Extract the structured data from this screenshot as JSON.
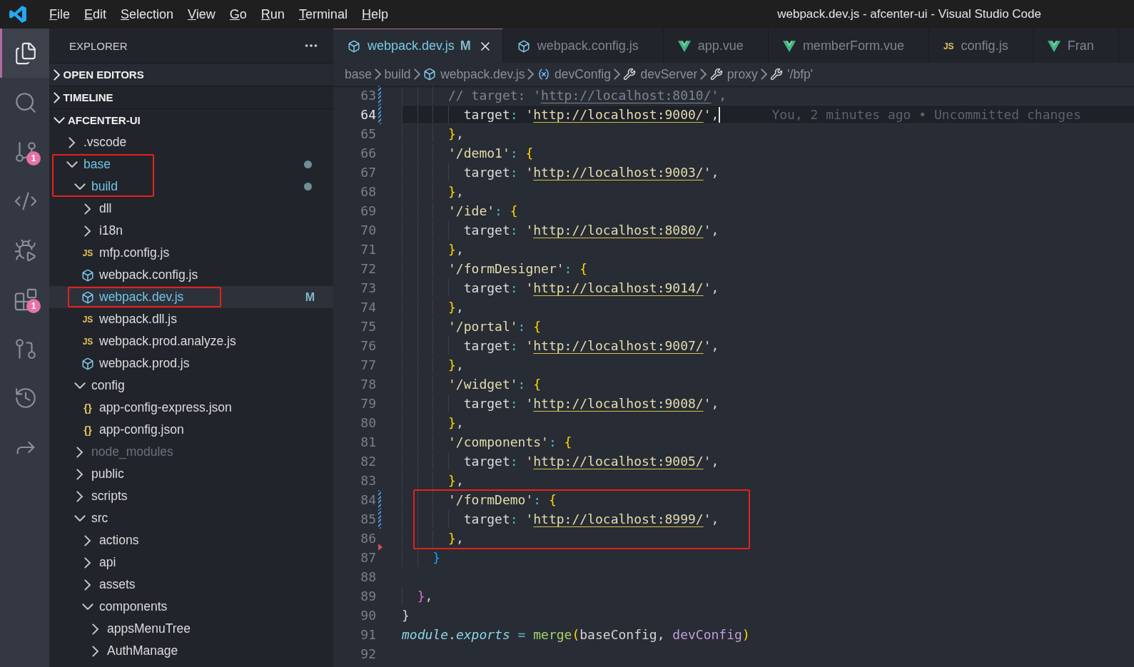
{
  "title_bar": {
    "menu": [
      "File",
      "Edit",
      "Selection",
      "View",
      "Go",
      "Run",
      "Terminal",
      "Help"
    ],
    "title": "webpack.dev.js - afcenter-ui - Visual Studio Code"
  },
  "activity_bar": [
    {
      "kind": "explorer",
      "selected": true
    },
    {
      "kind": "search",
      "selected": false
    },
    {
      "kind": "source-control",
      "selected": false,
      "badge": "1"
    },
    {
      "kind": "remote",
      "selected": false
    },
    {
      "kind": "debug",
      "selected": false
    },
    {
      "kind": "extensions",
      "selected": false,
      "badge": "1"
    },
    {
      "kind": "git-graph",
      "selected": false
    },
    {
      "kind": "git-history",
      "selected": false
    },
    {
      "kind": "share",
      "selected": false
    }
  ],
  "explorer": {
    "title": "EXPLORER",
    "sections": [
      {
        "title": "OPEN EDITORS",
        "expanded": false
      },
      {
        "title": "TIMELINE",
        "expanded": false
      },
      {
        "title": "AFCENTER-UI",
        "expanded": true,
        "tree": [
          {
            "label": ".vscode",
            "kind": "folder",
            "expanded": false,
            "selected": false,
            "modified": false,
            "ignored": false,
            "marked": false
          },
          {
            "label": "base",
            "kind": "folder",
            "expanded": true,
            "selected": false,
            "modified": true,
            "ignored": false,
            "marked": true,
            "children": [
              {
                "label": "build",
                "kind": "folder",
                "expanded": true,
                "selected": false,
                "modified": true,
                "ignored": false,
                "marked": true,
                "children": [
                  {
                    "label": "dll",
                    "kind": "folder",
                    "expanded": false,
                    "selected": false,
                    "modified": false,
                    "ignored": false,
                    "marked": false
                  },
                  {
                    "label": "i18n",
                    "kind": "folder",
                    "expanded": false,
                    "selected": false,
                    "modified": false,
                    "ignored": false,
                    "marked": false
                  },
                  {
                    "label": "mfp.config.js",
                    "kind": "file-js",
                    "icon_label": "JS",
                    "selected": false,
                    "modified": false,
                    "ignored": false,
                    "marked": false
                  },
                  {
                    "label": "webpack.config.js",
                    "kind": "file-webpack",
                    "selected": false,
                    "modified": false,
                    "ignored": false,
                    "marked": false
                  },
                  {
                    "label": "webpack.dev.js",
                    "kind": "file-webpack",
                    "selected": true,
                    "modified": true,
                    "status": "M",
                    "ignored": false,
                    "marked": true
                  },
                  {
                    "label": "webpack.dll.js",
                    "kind": "file-js",
                    "icon_label": "JS",
                    "selected": false,
                    "modified": false,
                    "ignored": false,
                    "marked": false
                  },
                  {
                    "label": "webpack.prod.analyze.js",
                    "kind": "file-js",
                    "icon_label": "JS",
                    "selected": false,
                    "modified": false,
                    "ignored": false,
                    "marked": false
                  },
                  {
                    "label": "webpack.prod.js",
                    "kind": "file-webpack",
                    "selected": false,
                    "modified": false,
                    "ignored": false,
                    "marked": false
                  }
                ]
              },
              {
                "label": "config",
                "kind": "folder",
                "expanded": true,
                "selected": false,
                "modified": false,
                "ignored": false,
                "marked": false,
                "children": [
                  {
                    "label": "app-config-express.json",
                    "kind": "file-json",
                    "icon_label": "{}",
                    "selected": false,
                    "modified": false,
                    "ignored": false,
                    "marked": false
                  },
                  {
                    "label": "app-config.json",
                    "kind": "file-json",
                    "icon_label": "{}",
                    "selected": false,
                    "modified": false,
                    "ignored": false,
                    "marked": false
                  }
                ]
              },
              {
                "label": "node_modules",
                "kind": "folder",
                "expanded": false,
                "selected": false,
                "modified": false,
                "ignored": true,
                "marked": false
              },
              {
                "label": "public",
                "kind": "folder",
                "expanded": false,
                "selected": false,
                "modified": false,
                "ignored": false,
                "marked": false
              },
              {
                "label": "scripts",
                "kind": "folder",
                "expanded": false,
                "selected": false,
                "modified": false,
                "ignored": false,
                "marked": false
              },
              {
                "label": "src",
                "kind": "folder",
                "expanded": true,
                "selected": false,
                "modified": false,
                "ignored": false,
                "marked": false,
                "children": [
                  {
                    "label": "actions",
                    "kind": "folder",
                    "expanded": false,
                    "selected": false,
                    "modified": false,
                    "ignored": false,
                    "marked": false
                  },
                  {
                    "label": "api",
                    "kind": "folder",
                    "expanded": false,
                    "selected": false,
                    "modified": false,
                    "ignored": false,
                    "marked": false
                  },
                  {
                    "label": "assets",
                    "kind": "folder",
                    "expanded": false,
                    "selected": false,
                    "modified": false,
                    "ignored": false,
                    "marked": false
                  },
                  {
                    "label": "components",
                    "kind": "folder",
                    "expanded": true,
                    "selected": false,
                    "modified": false,
                    "ignored": false,
                    "marked": false,
                    "children": [
                      {
                        "label": "appsMenuTree",
                        "kind": "folder",
                        "expanded": false,
                        "selected": false,
                        "modified": false,
                        "ignored": false,
                        "marked": false
                      },
                      {
                        "label": "AuthManage",
                        "kind": "folder",
                        "expanded": false,
                        "selected": false,
                        "modified": false,
                        "ignored": false,
                        "marked": false
                      }
                    ]
                  }
                ]
              }
            ]
          }
        ]
      }
    ]
  },
  "editor": {
    "tabs": [
      {
        "label": "webpack.dev.js",
        "kind": "webpack",
        "status": "M",
        "selected": true
      },
      {
        "label": "webpack.config.js",
        "kind": "webpack",
        "selected": false
      },
      {
        "label": "app.vue",
        "kind": "vue",
        "selected": false
      },
      {
        "label": "memberForm.vue",
        "kind": "vue",
        "selected": false
      },
      {
        "label": "config.js",
        "kind": "js",
        "icon_label": "JS",
        "selected": false
      },
      {
        "label": "Fran",
        "kind": "vue",
        "selected": false
      }
    ],
    "breadcrumb": [
      {
        "label": "base",
        "kind": "folder"
      },
      {
        "label": "build",
        "kind": "folder"
      },
      {
        "label": "webpack.dev.js",
        "kind": "file"
      },
      {
        "label": "devConfig",
        "kind": "variable"
      },
      {
        "label": "devServer",
        "kind": "property"
      },
      {
        "label": "proxy",
        "kind": "property"
      },
      {
        "label": "'/bfp'",
        "kind": "property"
      }
    ],
    "lines": [
      {
        "number": "63",
        "current": false,
        "kind": "modified",
        "marked": false,
        "tokens": [
          {
            "kind": "comment",
            "t": "      // target: '"
          },
          {
            "kind": "comment-link",
            "t": "http://localhost:8010/"
          },
          {
            "kind": "comment",
            "t": "',"
          }
        ]
      },
      {
        "number": "64",
        "current": true,
        "kind": "modified",
        "marked": false,
        "blame": "You, 2 minutes ago • Uncommitted changes",
        "tokens": [
          {
            "kind": "key",
            "t": "        target"
          },
          {
            "kind": "colon",
            "t": ": "
          },
          {
            "kind": "string",
            "t": "'"
          },
          {
            "kind": "link",
            "t": "http://localhost:9000/"
          },
          {
            "kind": "string",
            "t": "'"
          },
          {
            "kind": "punct",
            "t": ","
          }
        ]
      },
      {
        "number": "65",
        "current": false,
        "kind": "unchanged",
        "marked": false,
        "tokens": [
          {
            "kind": "brace-gold",
            "t": "      }"
          },
          {
            "kind": "punct",
            "t": ","
          }
        ]
      },
      {
        "number": "66",
        "current": false,
        "kind": "unchanged",
        "marked": false,
        "tokens": [
          {
            "kind": "string",
            "t": "      '/demo1'"
          },
          {
            "kind": "colon",
            "t": ": "
          },
          {
            "kind": "brace-gold",
            "t": "{"
          }
        ]
      },
      {
        "number": "67",
        "current": false,
        "kind": "unchanged",
        "marked": false,
        "tokens": [
          {
            "kind": "key",
            "t": "        target"
          },
          {
            "kind": "colon",
            "t": ": "
          },
          {
            "kind": "string",
            "t": "'"
          },
          {
            "kind": "link",
            "t": "http://localhost:9003/"
          },
          {
            "kind": "string",
            "t": "'"
          },
          {
            "kind": "punct",
            "t": ","
          }
        ]
      },
      {
        "number": "68",
        "current": false,
        "kind": "unchanged",
        "marked": false,
        "tokens": [
          {
            "kind": "brace-gold",
            "t": "      }"
          },
          {
            "kind": "punct",
            "t": ","
          }
        ]
      },
      {
        "number": "69",
        "current": false,
        "kind": "unchanged",
        "marked": false,
        "tokens": [
          {
            "kind": "string",
            "t": "      '/ide'"
          },
          {
            "kind": "colon",
            "t": ": "
          },
          {
            "kind": "brace-gold",
            "t": "{"
          }
        ]
      },
      {
        "number": "70",
        "current": false,
        "kind": "unchanged",
        "marked": false,
        "tokens": [
          {
            "kind": "key",
            "t": "        target"
          },
          {
            "kind": "colon",
            "t": ": "
          },
          {
            "kind": "string",
            "t": "'"
          },
          {
            "kind": "link",
            "t": "http://localhost:8080/"
          },
          {
            "kind": "string",
            "t": "'"
          },
          {
            "kind": "punct",
            "t": ","
          }
        ]
      },
      {
        "number": "71",
        "current": false,
        "kind": "unchanged",
        "marked": false,
        "tokens": [
          {
            "kind": "brace-gold",
            "t": "      }"
          },
          {
            "kind": "punct",
            "t": ","
          }
        ]
      },
      {
        "number": "72",
        "current": false,
        "kind": "unchanged",
        "marked": false,
        "tokens": [
          {
            "kind": "string",
            "t": "      '/formDesigner'"
          },
          {
            "kind": "colon",
            "t": ": "
          },
          {
            "kind": "brace-gold",
            "t": "{"
          }
        ]
      },
      {
        "number": "73",
        "current": false,
        "kind": "unchanged",
        "marked": false,
        "tokens": [
          {
            "kind": "key",
            "t": "        target"
          },
          {
            "kind": "colon",
            "t": ": "
          },
          {
            "kind": "string",
            "t": "'"
          },
          {
            "kind": "link",
            "t": "http://localhost:9014/"
          },
          {
            "kind": "string",
            "t": "'"
          },
          {
            "kind": "punct",
            "t": ","
          }
        ]
      },
      {
        "number": "74",
        "current": false,
        "kind": "unchanged",
        "marked": false,
        "tokens": [
          {
            "kind": "brace-gold",
            "t": "      }"
          },
          {
            "kind": "punct",
            "t": ","
          }
        ]
      },
      {
        "number": "75",
        "current": false,
        "kind": "unchanged",
        "marked": false,
        "tokens": [
          {
            "kind": "string",
            "t": "      '/portal'"
          },
          {
            "kind": "colon",
            "t": ": "
          },
          {
            "kind": "brace-gold",
            "t": "{"
          }
        ]
      },
      {
        "number": "76",
        "current": false,
        "kind": "unchanged",
        "marked": false,
        "tokens": [
          {
            "kind": "key",
            "t": "        target"
          },
          {
            "kind": "colon",
            "t": ": "
          },
          {
            "kind": "string",
            "t": "'"
          },
          {
            "kind": "link",
            "t": "http://localhost:9007/"
          },
          {
            "kind": "string",
            "t": "'"
          },
          {
            "kind": "punct",
            "t": ","
          }
        ]
      },
      {
        "number": "77",
        "current": false,
        "kind": "unchanged",
        "marked": false,
        "tokens": [
          {
            "kind": "brace-gold",
            "t": "      }"
          },
          {
            "kind": "punct",
            "t": ","
          }
        ]
      },
      {
        "number": "78",
        "current": false,
        "kind": "unchanged",
        "marked": false,
        "tokens": [
          {
            "kind": "string",
            "t": "      '/widget'"
          },
          {
            "kind": "colon",
            "t": ": "
          },
          {
            "kind": "brace-gold",
            "t": "{"
          }
        ]
      },
      {
        "number": "79",
        "current": false,
        "kind": "unchanged",
        "marked": false,
        "tokens": [
          {
            "kind": "key",
            "t": "        target"
          },
          {
            "kind": "colon",
            "t": ": "
          },
          {
            "kind": "string",
            "t": "'"
          },
          {
            "kind": "link",
            "t": "http://localhost:9008/"
          },
          {
            "kind": "string",
            "t": "'"
          },
          {
            "kind": "punct",
            "t": ","
          }
        ]
      },
      {
        "number": "80",
        "current": false,
        "kind": "unchanged",
        "marked": false,
        "tokens": [
          {
            "kind": "brace-gold",
            "t": "      }"
          },
          {
            "kind": "punct",
            "t": ","
          }
        ]
      },
      {
        "number": "81",
        "current": false,
        "kind": "unchanged",
        "marked": false,
        "tokens": [
          {
            "kind": "string",
            "t": "      '/components'"
          },
          {
            "kind": "colon",
            "t": ": "
          },
          {
            "kind": "brace-gold",
            "t": "{"
          }
        ]
      },
      {
        "number": "82",
        "current": false,
        "kind": "unchanged",
        "marked": false,
        "tokens": [
          {
            "kind": "key",
            "t": "        target"
          },
          {
            "kind": "colon",
            "t": ": "
          },
          {
            "kind": "string",
            "t": "'"
          },
          {
            "kind": "link",
            "t": "http://localhost:9005/"
          },
          {
            "kind": "string",
            "t": "'"
          },
          {
            "kind": "punct",
            "t": ","
          }
        ]
      },
      {
        "number": "83",
        "current": false,
        "kind": "unchanged",
        "marked": false,
        "tokens": [
          {
            "kind": "brace-gold",
            "t": "      }"
          },
          {
            "kind": "punct",
            "t": ","
          }
        ]
      },
      {
        "number": "84",
        "current": false,
        "kind": "modified",
        "marked": true,
        "tokens": [
          {
            "kind": "string",
            "t": "      '/formDemo'"
          },
          {
            "kind": "colon",
            "t": ": "
          },
          {
            "kind": "brace-gold",
            "t": "{"
          }
        ]
      },
      {
        "number": "85",
        "current": false,
        "kind": "modified",
        "marked": true,
        "tokens": [
          {
            "kind": "key",
            "t": "        target"
          },
          {
            "kind": "colon",
            "t": ": "
          },
          {
            "kind": "string",
            "t": "'"
          },
          {
            "kind": "link",
            "t": "http://localhost:8999/"
          },
          {
            "kind": "string",
            "t": "'"
          },
          {
            "kind": "punct",
            "t": ","
          }
        ]
      },
      {
        "number": "86",
        "current": false,
        "kind": "deleted",
        "marked": true,
        "tokens": [
          {
            "kind": "brace-gold",
            "t": "      }"
          },
          {
            "kind": "punct",
            "t": ","
          }
        ]
      },
      {
        "number": "87",
        "current": false,
        "kind": "unchanged",
        "marked": false,
        "tokens": [
          {
            "kind": "brace-blue",
            "t": "    }"
          }
        ]
      },
      {
        "number": "88",
        "current": false,
        "kind": "unchanged",
        "marked": false
      },
      {
        "number": "89",
        "current": false,
        "kind": "unchanged",
        "marked": false,
        "tokens": [
          {
            "kind": "brace-orchid",
            "t": "  }"
          },
          {
            "kind": "punct",
            "t": ","
          }
        ]
      },
      {
        "number": "90",
        "current": false,
        "kind": "unchanged",
        "marked": false,
        "tokens": [
          {
            "kind": "plain",
            "t": "}"
          }
        ]
      },
      {
        "number": "91",
        "current": false,
        "kind": "unchanged",
        "marked": false,
        "tokens": [
          {
            "kind": "object",
            "t": "module"
          },
          {
            "kind": "punct",
            "t": "."
          },
          {
            "kind": "object",
            "t": "exports"
          },
          {
            "kind": "operator",
            "t": " = "
          },
          {
            "kind": "function",
            "t": "merge"
          },
          {
            "kind": "brace-gold",
            "t": "("
          },
          {
            "kind": "plain",
            "t": "baseConfig, "
          },
          {
            "kind": "param",
            "t": "devConfig"
          },
          {
            "kind": "brace-gold",
            "t": ")"
          }
        ]
      },
      {
        "number": "92",
        "current": false,
        "kind": "unchanged",
        "marked": false
      }
    ]
  }
}
